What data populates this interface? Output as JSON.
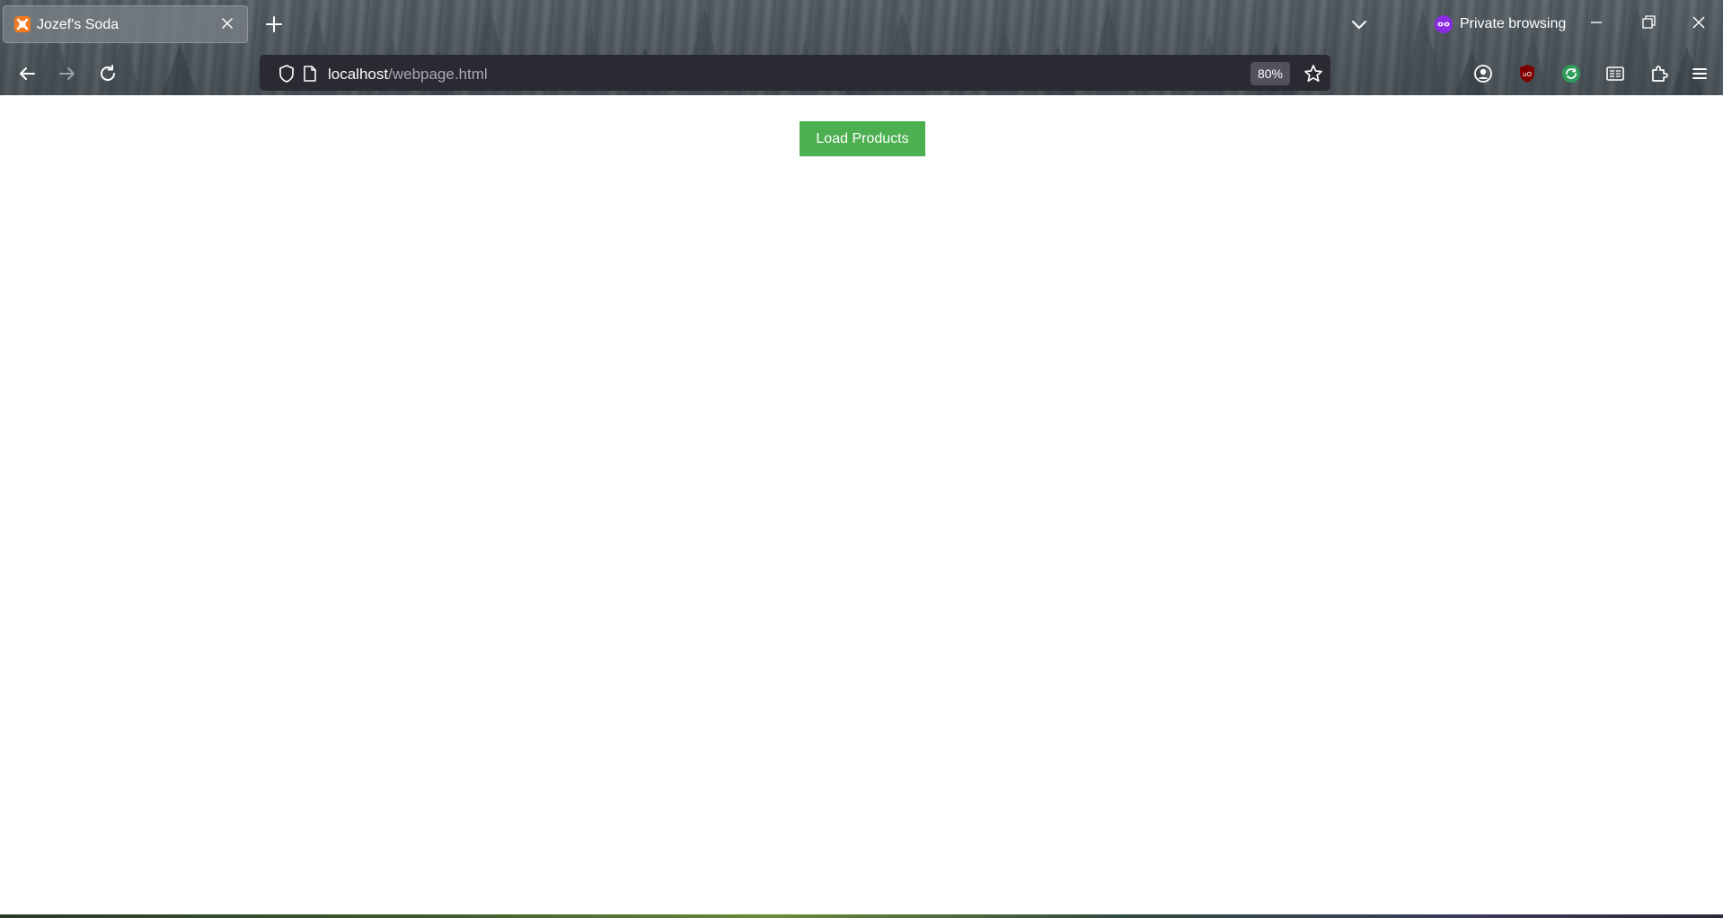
{
  "window": {
    "private_label": "Private browsing"
  },
  "tabs": [
    {
      "title": "Jozef's Soda",
      "favicon": "xampp-icon",
      "active": true
    }
  ],
  "toolbar": {
    "url_host": "localhost",
    "url_path": "/webpage.html",
    "zoom": "80%"
  },
  "page": {
    "load_button_label": "Load Products",
    "button_color": "#4caf50"
  },
  "colors": {
    "private_accent": "#8a2be2",
    "ublock_red": "#800000",
    "favicon_orange": "#f47b20"
  }
}
